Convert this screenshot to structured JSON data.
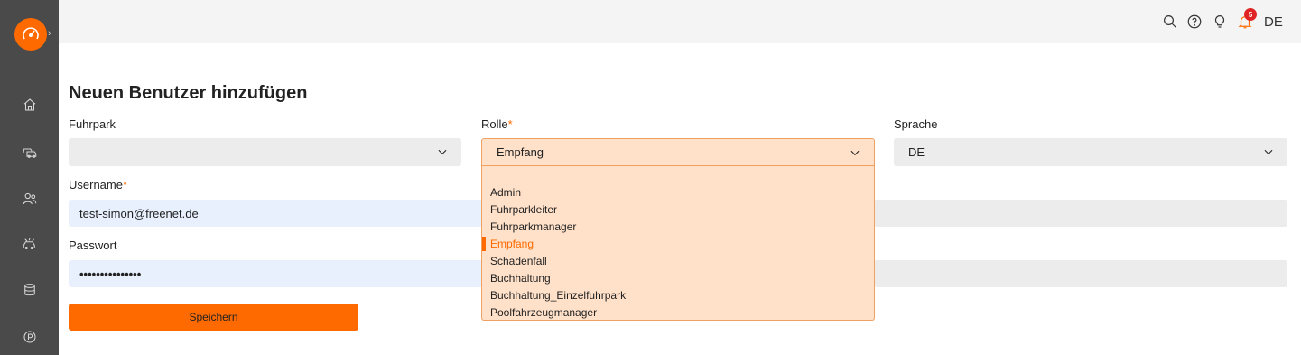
{
  "header": {
    "language": "DE",
    "notification_count": "5"
  },
  "page": {
    "title": "Neuen Benutzer hinzufügen"
  },
  "form": {
    "fuhrpark_label": "Fuhrpark",
    "fuhrpark_value": "",
    "rolle_label": "Rolle",
    "rolle_value": "Empfang",
    "sprache_label": "Sprache",
    "sprache_value": "DE",
    "username_label": "Username",
    "username_value": "test-simon@freenet.de",
    "passwort_label": "Passwort",
    "passwort_value": "•••••••••••••••",
    "required_mark": "*",
    "save_label": "Speichern"
  },
  "rolle_options": [
    "Admin",
    "Fuhrparkleiter",
    "Fuhrparkmanager",
    "Empfang",
    "Schadenfall",
    "Buchhaltung",
    "Buchhaltung_Einzelfuhrpark",
    "Poolfahrzeugmanager"
  ],
  "rolle_selected_index": 3,
  "sidebar": {
    "items": [
      "home-icon",
      "vehicles-icon",
      "users-icon",
      "damage-car-icon",
      "database-icon",
      "parking-icon"
    ]
  },
  "colors": {
    "accent": "#ff6a00",
    "sidebar": "#4a4a4a",
    "badge": "#e02424"
  }
}
